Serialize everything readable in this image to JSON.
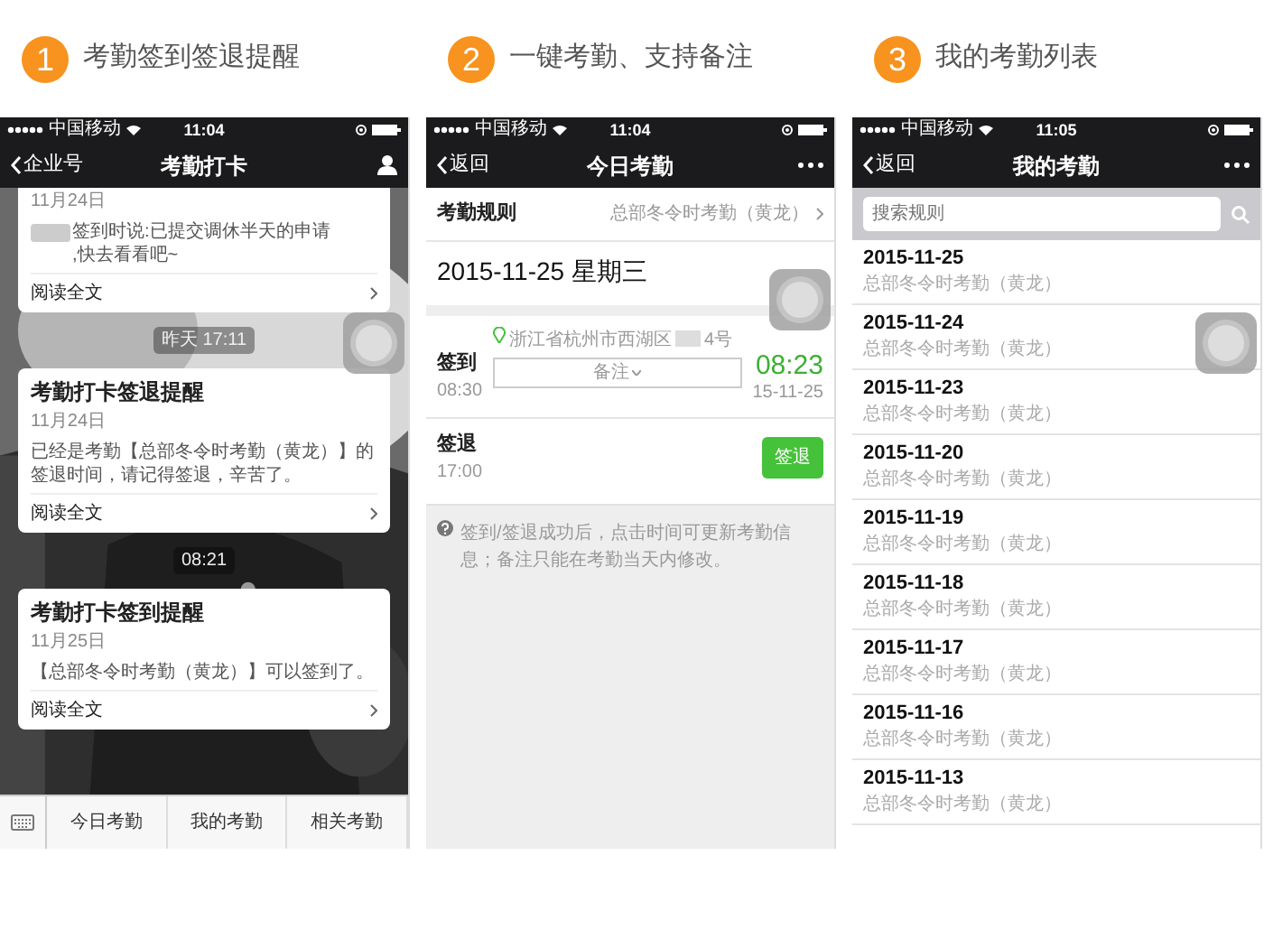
{
  "steps": [
    {
      "number": "1",
      "title": "考勤签到签退提醒"
    },
    {
      "number": "2",
      "title": "一键考勤、支持备注"
    },
    {
      "number": "3",
      "title": "我的考勤列表"
    }
  ],
  "messages_screen": {
    "status_bar": {
      "carrier": "中国移动",
      "time": "11:04"
    },
    "nav": {
      "back": "企业号",
      "title": "考勤打卡"
    },
    "items": [
      {
        "kind": "card_cut",
        "date": "11月24日",
        "body": "签到时说:已提交调休半天的申请\n,快去看看吧~",
        "link": "阅读全文"
      },
      {
        "kind": "time",
        "text": "昨天 17:11"
      },
      {
        "kind": "card",
        "title": "考勤打卡签退提醒",
        "date": "11月24日",
        "body": "已经是考勤【总部冬令时考勤（黄龙）】的签退时间，请记得签退，辛苦了。",
        "link": "阅读全文"
      },
      {
        "kind": "time",
        "text": "08:21"
      },
      {
        "kind": "card",
        "title": "考勤打卡签到提醒",
        "date": "11月25日",
        "body": "【总部冬令时考勤（黄龙）】可以签到了。",
        "link": "阅读全文"
      }
    ],
    "menu": [
      "今日考勤",
      "我的考勤",
      "相关考勤"
    ]
  },
  "today_screen": {
    "status_bar": {
      "carrier": "中国移动",
      "time": "11:04"
    },
    "nav": {
      "back": "返回",
      "title": "今日考勤"
    },
    "rule": {
      "label": "考勤规则",
      "value": "总部冬令时考勤（黄龙）"
    },
    "date": "2015-11-25 星期三",
    "check_in": {
      "label": "签到",
      "time": "08:30",
      "address": "浙江省杭州市西湖区",
      "address_end": "4号",
      "remark_button": "备注",
      "record_time": "08:23",
      "record_date": "15-11-25"
    },
    "check_out": {
      "label": "签退",
      "time": "17:00",
      "button": "签退"
    },
    "note": "签到/签退成功后，点击时间可更新考勤信息；备注只能在考勤当天内修改。"
  },
  "list_screen": {
    "status_bar": {
      "carrier": "中国移动",
      "time": "11:05"
    },
    "nav": {
      "back": "返回",
      "title": "我的考勤"
    },
    "search": {
      "placeholder": "搜索规则"
    },
    "records": [
      {
        "date": "2015-11-25",
        "rule": "总部冬令时考勤（黄龙）"
      },
      {
        "date": "2015-11-24",
        "rule": "总部冬令时考勤（黄龙）"
      },
      {
        "date": "2015-11-23",
        "rule": "总部冬令时考勤（黄龙）"
      },
      {
        "date": "2015-11-20",
        "rule": "总部冬令时考勤（黄龙）"
      },
      {
        "date": "2015-11-19",
        "rule": "总部冬令时考勤（黄龙）"
      },
      {
        "date": "2015-11-18",
        "rule": "总部冬令时考勤（黄龙）"
      },
      {
        "date": "2015-11-17",
        "rule": "总部冬令时考勤（黄龙）"
      },
      {
        "date": "2015-11-16",
        "rule": "总部冬令时考勤（黄龙）"
      },
      {
        "date": "2015-11-13",
        "rule": "总部冬令时考勤（黄龙）"
      }
    ]
  }
}
